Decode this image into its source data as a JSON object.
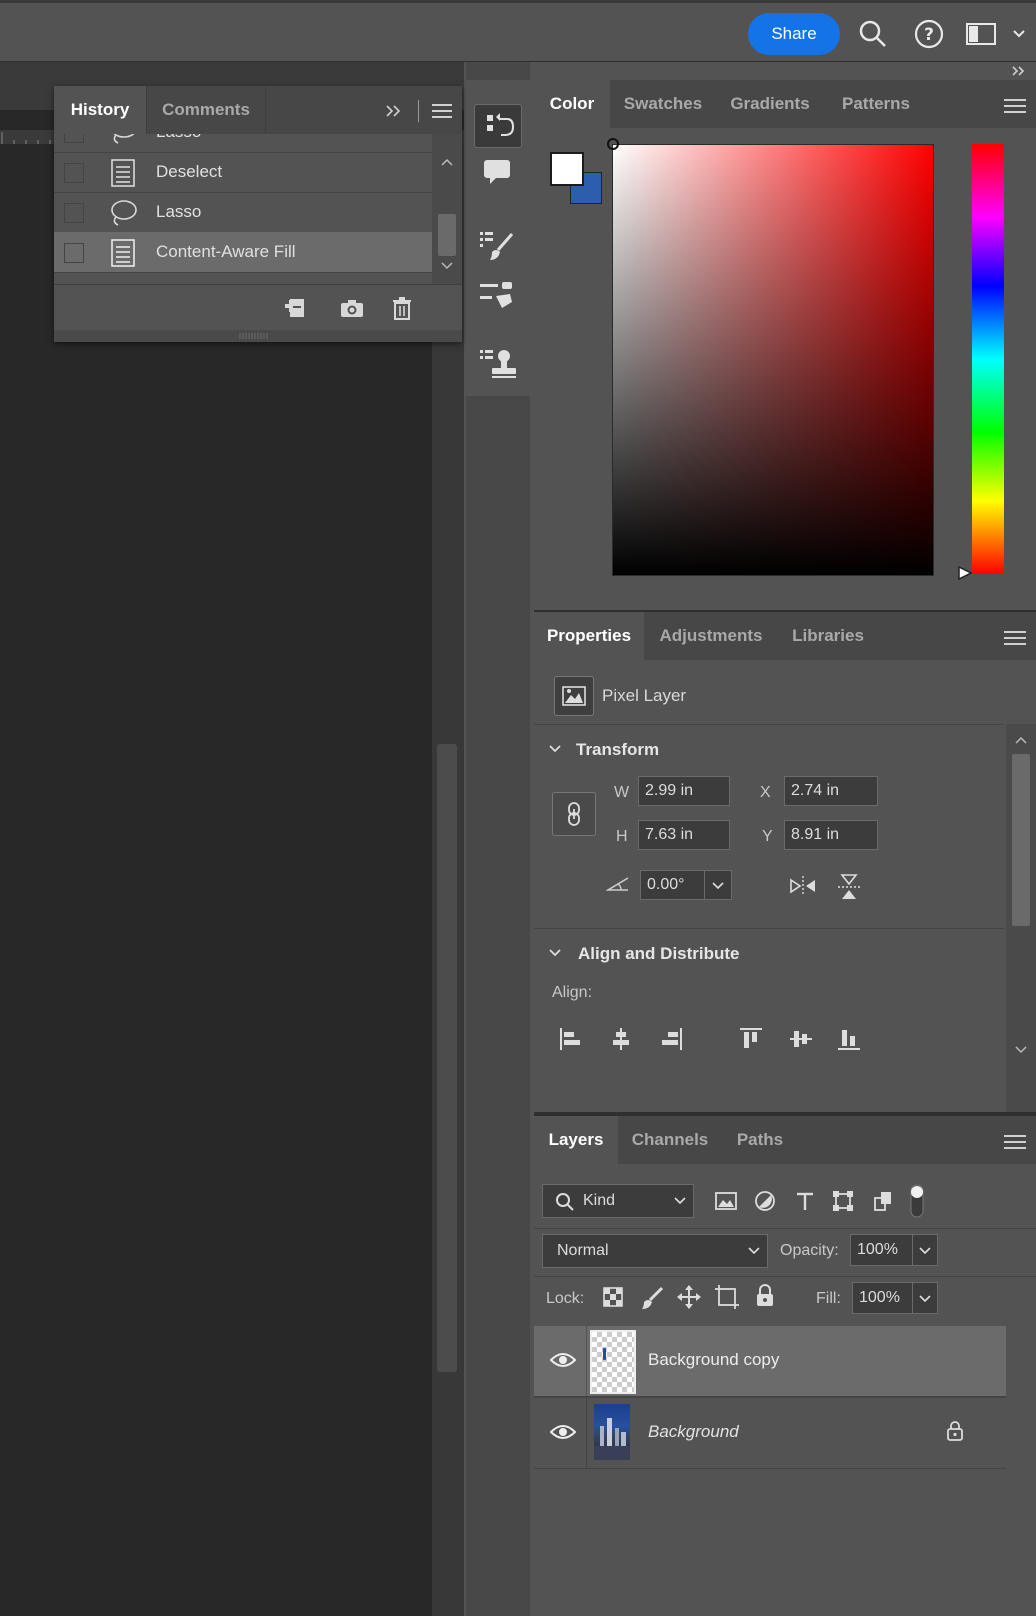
{
  "topbar": {
    "share_label": "Share",
    "icons": [
      "search-icon",
      "help-icon",
      "workspace-icon",
      "chevron-down-icon"
    ]
  },
  "history": {
    "tabs": [
      "History",
      "Comments"
    ],
    "rows": [
      {
        "label": "Lasso",
        "icon": "lasso-icon"
      },
      {
        "label": "Deselect",
        "icon": "document-icon"
      },
      {
        "label": "Lasso",
        "icon": "lasso-icon"
      },
      {
        "label": "Content-Aware Fill",
        "icon": "document-icon"
      }
    ],
    "footer_icons": [
      "new-document-from-state-icon",
      "snapshot-camera-icon",
      "trash-icon"
    ]
  },
  "color": {
    "tabs": [
      "Color",
      "Swatches",
      "Gradients",
      "Patterns"
    ],
    "foreground": "#ffffff",
    "background": "#2b5fad",
    "hue": "#ff0000"
  },
  "properties": {
    "tabs": [
      "Properties",
      "Adjustments",
      "Libraries"
    ],
    "layer_type": "Pixel Layer",
    "transform_title": "Transform",
    "w_label": "W",
    "w_value": "2.99 in",
    "h_label": "H",
    "h_value": "7.63 in",
    "x_label": "X",
    "x_value": "2.74 in",
    "y_label": "Y",
    "y_value": "8.91 in",
    "angle_value": "0.00°",
    "align_title": "Align and Distribute",
    "align_label": "Align:"
  },
  "layers": {
    "tabs": [
      "Layers",
      "Channels",
      "Paths"
    ],
    "filter_kind": "Kind",
    "blend_mode": "Normal",
    "opacity_label": "Opacity:",
    "opacity_value": "100%",
    "lock_label": "Lock:",
    "fill_label": "Fill:",
    "fill_value": "100%",
    "items": [
      {
        "name": "Background copy",
        "selected": true
      },
      {
        "name": "Background",
        "selected": false,
        "locked": true
      }
    ]
  },
  "colors": {
    "accent": "#1473e6",
    "panel": "#535353",
    "selected_row": "#6b6b6b"
  }
}
